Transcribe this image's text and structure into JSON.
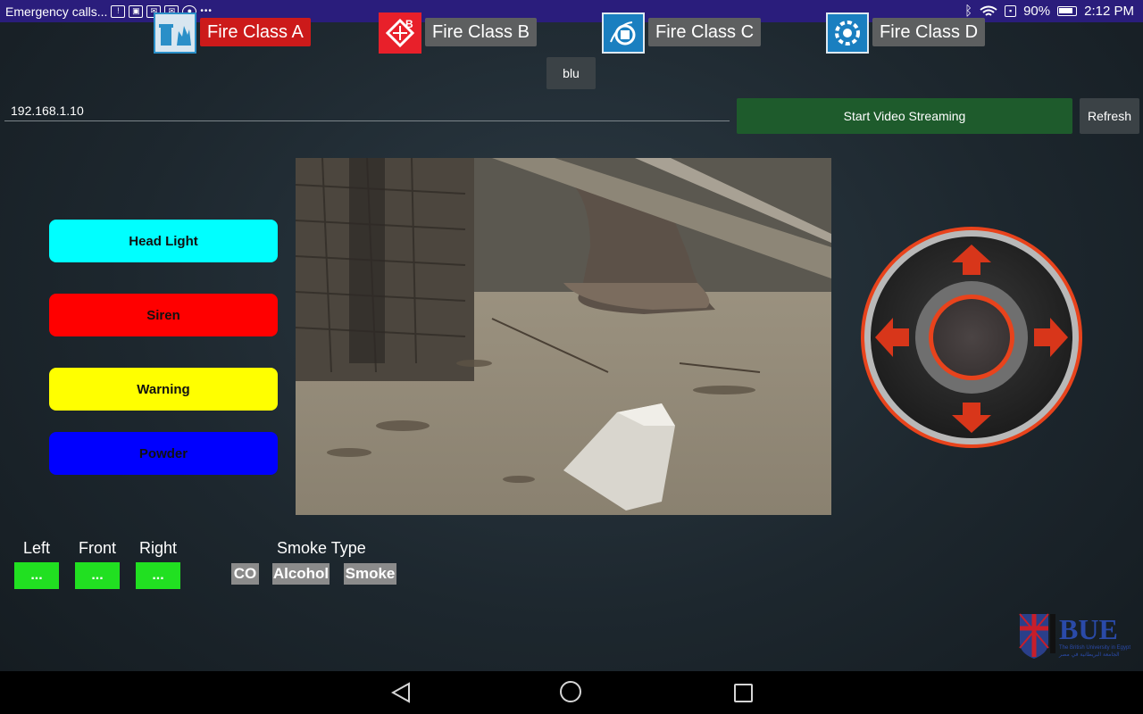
{
  "status_bar": {
    "notification_text": "Emergency calls...",
    "icons": [
      "alert-photo-icon",
      "image-icon",
      "mail-icon",
      "mail-icon",
      "record-icon"
    ],
    "overflow": "•••",
    "battery": "90%",
    "time": "2:12 PM",
    "bar_color": "#2a1d7c"
  },
  "fire_classes": [
    {
      "label": "Fire Class A",
      "icon": "fire-class-a-icon",
      "active": true
    },
    {
      "label": "Fire Class B",
      "icon": "fire-class-b-icon",
      "active": false
    },
    {
      "label": "Fire Class C",
      "icon": "fire-class-c-icon",
      "active": false
    },
    {
      "label": "Fire Class D",
      "icon": "fire-class-d-icon",
      "active": false
    }
  ],
  "bluetooth_button": "blu",
  "ip_field": {
    "value": "192.168.1.10"
  },
  "stream_button": "Start Video Streaming",
  "refresh_button": "Refresh",
  "controls": [
    {
      "label": "Head Light",
      "color": "#00ffff"
    },
    {
      "label": "Siren",
      "color": "#ff0000"
    },
    {
      "label": "Warning",
      "color": "#ffff00"
    },
    {
      "label": "Powder",
      "color": "#0000ff"
    }
  ],
  "sensors": [
    {
      "label": "Left",
      "value": "..."
    },
    {
      "label": "Front",
      "value": "..."
    },
    {
      "label": "Right",
      "value": "..."
    }
  ],
  "smoke": {
    "title": "Smoke Type",
    "types": [
      "CO",
      "Alcohol",
      "Smoke"
    ]
  },
  "logo": {
    "name": "BUE",
    "subtitle": "The British University in Egypt",
    "subtitle_ar": "الجامعة البريطانية في مصر"
  },
  "colors": {
    "active_fire": "#cc1a1a",
    "inactive_fire": "#5d5f60",
    "stream_green": "#1e5b2c",
    "sensor_green": "#21e021",
    "joystick_accent": "#e8431c"
  }
}
